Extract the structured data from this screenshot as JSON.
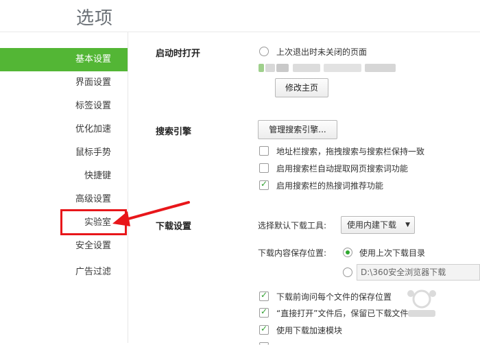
{
  "header": {
    "title": "选项"
  },
  "sidebar": {
    "items": [
      {
        "label": "基本设置",
        "active": true
      },
      {
        "label": "界面设置"
      },
      {
        "label": "标签设置"
      },
      {
        "label": "优化加速"
      },
      {
        "label": "鼠标手势"
      },
      {
        "label": "快捷键"
      },
      {
        "label": "高级设置"
      },
      {
        "label": "实验室"
      },
      {
        "label": "安全设置"
      },
      {
        "label": "广告过滤"
      }
    ]
  },
  "startup": {
    "title": "启动时打开",
    "radio_label": "上次退出时未关闭的页面",
    "radio_checked": false,
    "change_home_button": "修改主页"
  },
  "search": {
    "title": "搜索引擎",
    "manage_button": "管理搜索引擎...",
    "options": [
      {
        "label": "地址栏搜索，拖拽搜索与搜索栏保持一致",
        "checked": false
      },
      {
        "label": "启用搜索栏自动提取网页搜索词功能",
        "checked": false
      },
      {
        "label": "启用搜索栏的热搜词推荐功能",
        "checked": true
      }
    ]
  },
  "download": {
    "title": "下载设置",
    "tool_label": "选择默认下载工具:",
    "tool_selected": "使用内建下载",
    "save_location_label": "下载内容保存位置:",
    "last_dir_label": "使用上次下载目录",
    "last_dir_checked": true,
    "custom_dir_checked": false,
    "custom_dir_path": "D:\\360安全浏览器下载",
    "options": [
      {
        "label": "下载前询问每个文件的保存位置",
        "checked": true
      },
      {
        "label": "“直接打开”文件后，保留已下载文件",
        "checked": true
      },
      {
        "label": "使用下载加速模块",
        "checked": true
      }
    ]
  },
  "colors": {
    "accent": "#53b635",
    "highlight": "#e8161a"
  }
}
